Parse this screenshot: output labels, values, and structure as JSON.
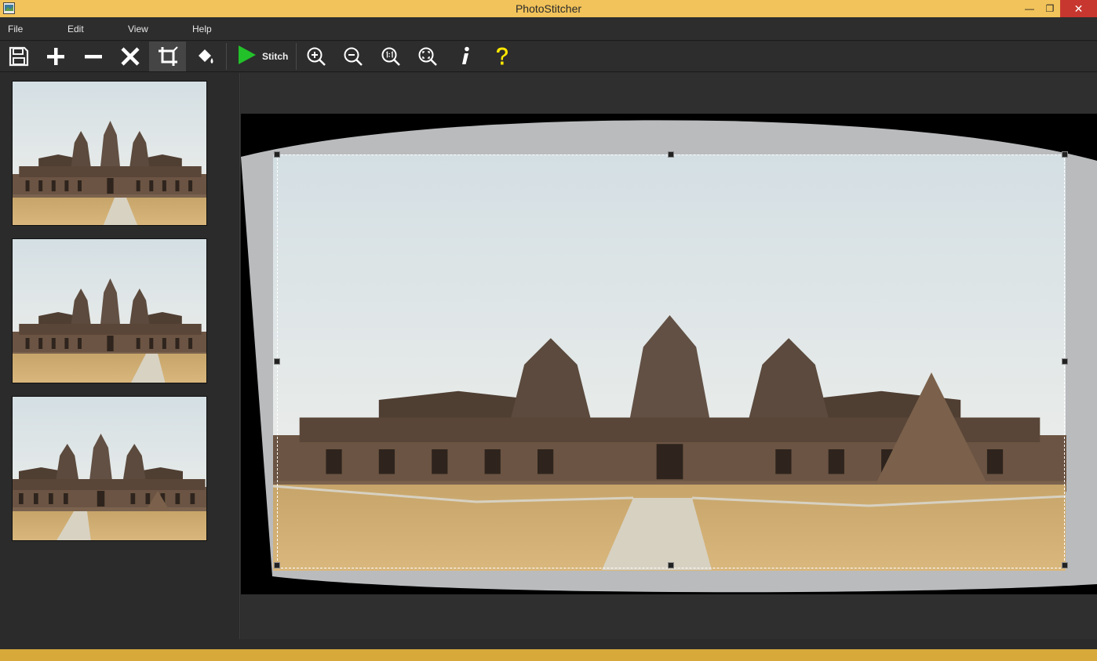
{
  "window": {
    "title": "PhotoStitcher"
  },
  "menu": {
    "items": [
      "File",
      "Edit",
      "View",
      "Help"
    ]
  },
  "toolbar": {
    "stitch_label": "Stitch",
    "icons": [
      "save-icon",
      "add-icon",
      "remove-icon",
      "clear-icon",
      "crop-icon",
      "fill-icon",
      "stitch-play-icon",
      "zoom-in-icon",
      "zoom-out-icon",
      "actual-size-icon",
      "fit-to-window-icon",
      "info-icon",
      "help-icon"
    ],
    "active_tool": "crop-icon"
  },
  "thumbnails": {
    "count": 3
  },
  "colors": {
    "title_bar": "#f1c35a",
    "stitch_play": "#22c12a",
    "help_icon": "#ffe800"
  }
}
